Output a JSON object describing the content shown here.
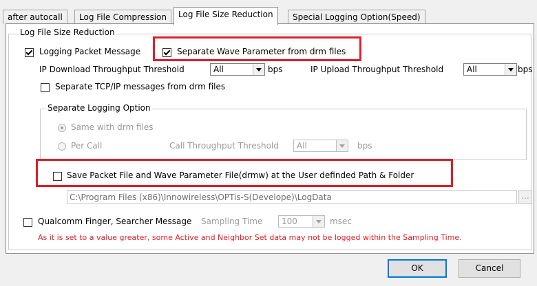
{
  "tabs": [
    {
      "label": "after autocall"
    },
    {
      "label": "Log File Compression"
    },
    {
      "label": "Log File Size Reduction"
    },
    {
      "label": "Special Logging Option(Speed)"
    }
  ],
  "group_main": {
    "label": "Log File Size Reduction"
  },
  "logging_packet": {
    "label": "Logging Packet Message",
    "checked": true
  },
  "separate_wave": {
    "label": "Separate Wave Parameter from drm files",
    "checked": true
  },
  "ip_download": {
    "label": "IP Download Throughput Threshold",
    "value": "All",
    "unit": "bps"
  },
  "ip_upload": {
    "label": "IP Upload Throughput Threshold",
    "value": "All",
    "unit": "bps"
  },
  "separate_tcp": {
    "label": "Separate TCP/IP messages from drm files",
    "checked": false
  },
  "separate_logging": {
    "label": "Separate Logging Option",
    "same_with_drm": "Same with drm files",
    "per_call": "Per Call",
    "call_threshold_label": "Call Throughput Threshold",
    "call_threshold_value": "All",
    "call_threshold_unit": "bps"
  },
  "save_packet": {
    "label": "Save Packet File and Wave Parameter File(drmw) at the User definded Path & Folder",
    "checked": false
  },
  "path": {
    "value": "C:\\Program Files (x86)\\Innowireless\\OPTis-S(Develope)\\LogData",
    "browse_label": "..."
  },
  "qualcomm": {
    "label": "Qualcomm Finger, Searcher Message",
    "sampling_label": "Sampling Time",
    "sampling_value": "100",
    "sampling_unit": "msec",
    "warning": "As it is set to a value greater, some Active and Neighbor Set data may not be logged within the Sampling Time."
  },
  "buttons": {
    "ok": "OK",
    "cancel": "Cancel"
  },
  "colors": {
    "highlight": "#e01e24",
    "warning": "#e01e24",
    "disabled_text": "#9a9a9a"
  }
}
